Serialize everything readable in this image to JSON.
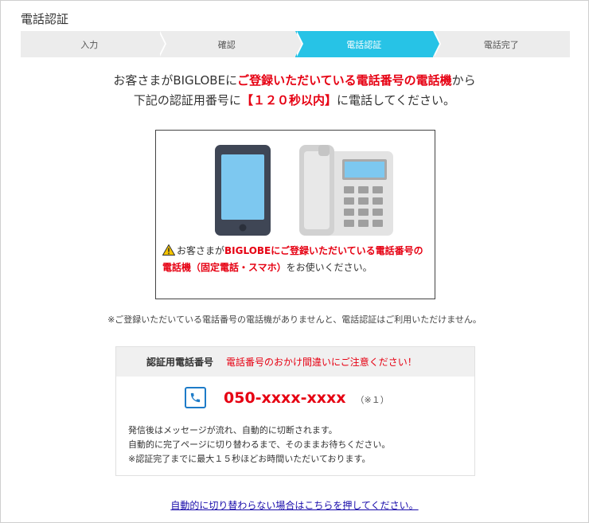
{
  "page": {
    "title": "電話認証"
  },
  "stepper": {
    "steps": [
      {
        "label": "入力",
        "active": false
      },
      {
        "label": "確認",
        "active": false
      },
      {
        "label": "電話認証",
        "active": true
      },
      {
        "label": "電話完了",
        "active": false
      }
    ]
  },
  "lead": {
    "line1_before": "お客さまがBIGLOBEに",
    "line1_emph": "ご登録いただいている電話番号の電話機",
    "line1_after": "から",
    "line2_before": "下記の認証用番号に",
    "line2_emph": "【１２０秒以内】",
    "line2_after": "に電話してください。"
  },
  "illustration": {
    "note_before": "お客さまが",
    "note_emph": "BIGLOBEにご登録いただいている電話番号の電話機（固定電話・スマホ）",
    "note_after": "をお使いください。"
  },
  "footnote": "※ご登録いただいている電話番号の電話機がありませんと、電話認証はご利用いただけません。",
  "panel": {
    "label": "認証用電話番号",
    "warning": "電話番号のおかけ間違いにご注意ください！",
    "number": "050-xxxx-xxxx",
    "number_note": "（※１）",
    "body_lines": [
      "発信後はメッセージが流れ、自動的に切断されます。",
      "自動的に完了ページに切り替わるまで、そのままお待ちください。",
      "※認証完了までに最大１５秒ほどお時間いただいております。"
    ]
  },
  "link": "自動的に切り替わらない場合はこちらを押してください。",
  "colors": {
    "accent": "#27c3e6",
    "emphasis": "#e60012",
    "link": "#1a0dab"
  }
}
